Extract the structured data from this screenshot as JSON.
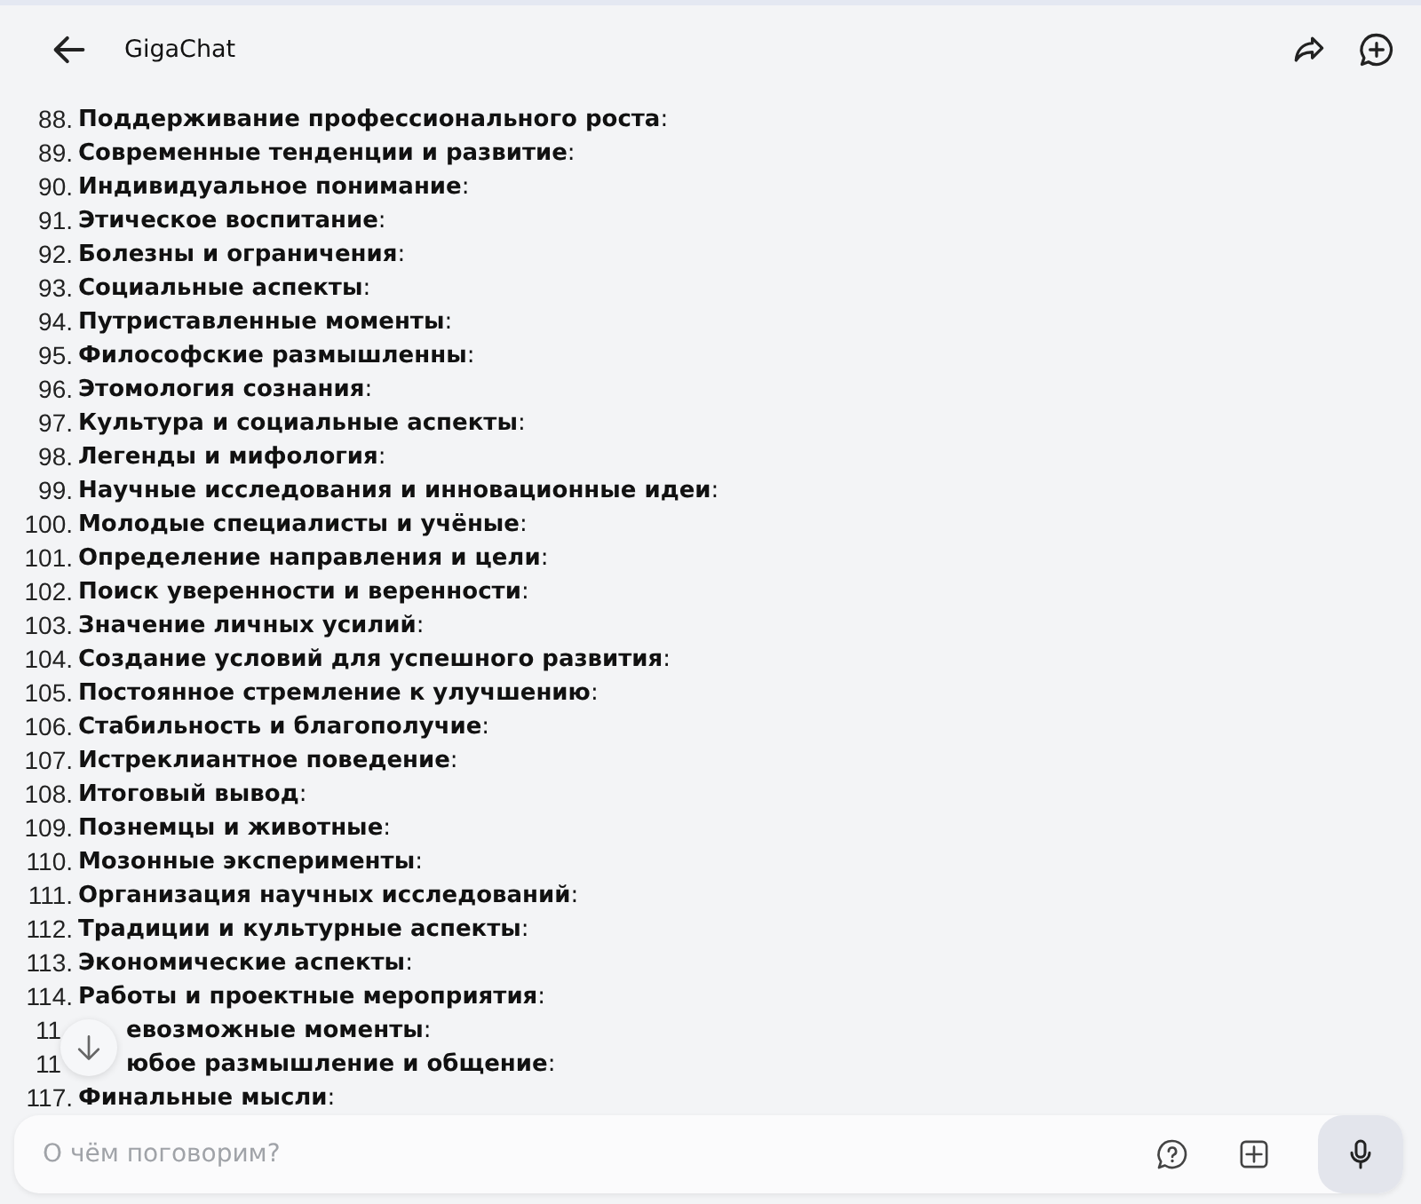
{
  "header": {
    "title": "GigaChat"
  },
  "items": [
    {
      "kind": "item",
      "number": "88.",
      "text": "**Поддерживание профессионального роста**:"
    },
    {
      "kind": "item",
      "number": "89.",
      "text": "**Современные тенденции и развитие**:"
    },
    {
      "kind": "item",
      "number": "90.",
      "text": "**Индивидуальное понимание**:"
    },
    {
      "kind": "item",
      "number": "91.",
      "text": "**Этическое воспитание**:"
    },
    {
      "kind": "item",
      "number": "92.",
      "text": "**Болезны и ограничения**:"
    },
    {
      "kind": "item",
      "number": "93.",
      "text": "**Социальные аспекты**:"
    },
    {
      "kind": "item",
      "number": "94.",
      "text": "**Путриставленные моменты**:"
    },
    {
      "kind": "item",
      "number": "95.",
      "text": "**Философские размышленны**:"
    },
    {
      "kind": "item",
      "number": "96.",
      "text": "**Этомология сознания**:"
    },
    {
      "kind": "item",
      "number": "97.",
      "text": "**Культура и социальные аспекты**:"
    },
    {
      "kind": "item",
      "number": "98.",
      "text": "**Легенды и мифология**:"
    },
    {
      "kind": "item",
      "number": "99.",
      "text": "**Научные исследования и инновационные идеи**:"
    },
    {
      "kind": "item",
      "number": "100.",
      "text": "**Молодые специалисты и учёные**:"
    },
    {
      "kind": "item",
      "number": "101.",
      "text": "**Определение направления и цели**:"
    },
    {
      "kind": "item",
      "number": "102.",
      "text": "**Поиск уверенности и веренности**:"
    },
    {
      "kind": "item",
      "number": "103.",
      "text": "**Значение личных усилий**:"
    },
    {
      "kind": "item",
      "number": "104.",
      "text": "**Создание условий для успешного развития**:"
    },
    {
      "kind": "item",
      "number": "105.",
      "text": "**Постоянное стремление к улучшению**:"
    },
    {
      "kind": "item",
      "number": "106.",
      "text": "**Стабильность и благополучие**:"
    },
    {
      "kind": "item",
      "number": "107.",
      "text": "**Истреклиантное поведение**:"
    },
    {
      "kind": "item",
      "number": "108.",
      "text": "**Итоговый вывод**:"
    },
    {
      "kind": "item",
      "number": "109.",
      "text": "**Познемцы и животные**:"
    },
    {
      "kind": "item",
      "number": "110.",
      "text": "**Мозонные эксперименты**:"
    },
    {
      "kind": "item",
      "number": "111.",
      "text": "**Организация научных исследований**:"
    },
    {
      "kind": "item",
      "number": "112.",
      "text": "**Традиции и культурные аспекты**:"
    },
    {
      "kind": "item",
      "number": "113.",
      "text": "**Экономические аспекты**:"
    },
    {
      "kind": "item",
      "number": "114.",
      "text": "**Работы и проектные мероприятия**:"
    },
    {
      "kind": "covered",
      "number": "11",
      "text": "**евозможные моменты**:"
    },
    {
      "kind": "covered",
      "number": "11",
      "text": "**юбое размышление и общение**:"
    },
    {
      "kind": "item",
      "number": "117.",
      "text": "**Финальные мысли**:"
    }
  ],
  "composer": {
    "placeholder": "О чём поговорим?"
  }
}
